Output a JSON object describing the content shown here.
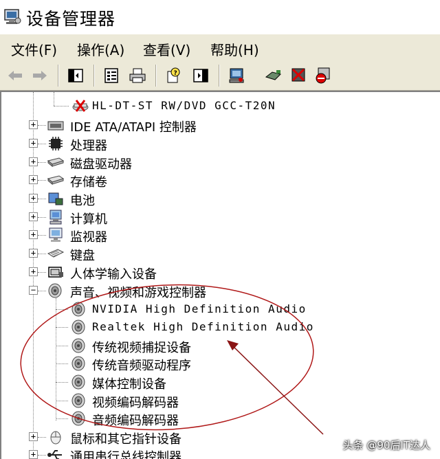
{
  "window": {
    "title": "设备管理器"
  },
  "menu": [
    {
      "label": "文件(F)"
    },
    {
      "label": "操作(A)"
    },
    {
      "label": "查看(V)"
    },
    {
      "label": "帮助(H)"
    }
  ],
  "toolbar": [
    "back-arrow-icon",
    "forward-arrow-icon",
    "show-hide-tree-icon",
    "properties-icon",
    "print-icon",
    "help-icon",
    "show-hide-action-pane-icon",
    "scan-hardware-icon",
    "update-driver-icon",
    "uninstall-icon",
    "disable-icon"
  ],
  "tree": {
    "dvd_drive": "HL-DT-ST RW/DVD GCC-T20N",
    "categories": [
      {
        "label": "IDE ATA/ATAPI 控制器",
        "icon": "ide-controller-icon",
        "expanded": false
      },
      {
        "label": "处理器",
        "icon": "processor-icon",
        "expanded": false
      },
      {
        "label": "磁盘驱动器",
        "icon": "disk-drive-icon",
        "expanded": false
      },
      {
        "label": "存储卷",
        "icon": "storage-volume-icon",
        "expanded": false
      },
      {
        "label": "电池",
        "icon": "battery-icon",
        "expanded": false
      },
      {
        "label": "计算机",
        "icon": "computer-icon",
        "expanded": false
      },
      {
        "label": "监视器",
        "icon": "monitor-icon",
        "expanded": false
      },
      {
        "label": "键盘",
        "icon": "keyboard-icon",
        "expanded": false
      },
      {
        "label": "人体学输入设备",
        "icon": "hid-icon",
        "expanded": false
      },
      {
        "label": "声音、视频和游戏控制器",
        "icon": "speaker-icon",
        "expanded": true
      }
    ],
    "sound_children": [
      "NVIDIA High Definition Audio",
      "Realtek High Definition Audio",
      "传统视频捕捉设备",
      "传统音频驱动程序",
      "媒体控制设备",
      "视频编码解码器",
      "音频编码解码器"
    ],
    "after": [
      {
        "label": "鼠标和其它指针设备",
        "icon": "mouse-icon",
        "expanded": false
      },
      {
        "label": "通用串行总线控制器",
        "icon": "usb-icon",
        "expanded": false
      }
    ]
  },
  "watermark": "头条 @90后IT达人",
  "colors": {
    "menubar_bg": "#ece9d8",
    "annotation": "#b01818"
  }
}
